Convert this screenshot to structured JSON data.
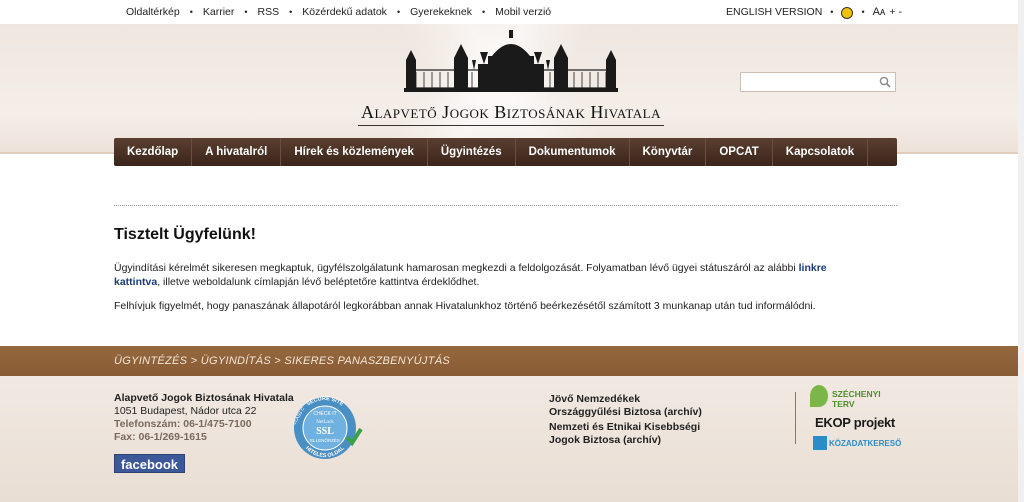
{
  "topbar": {
    "links": [
      "Oldaltérkép",
      "Karrier",
      "RSS",
      "Közérdekű adatok",
      "Gyerekeknek",
      "Mobil verzió"
    ],
    "english": "ENGLISH VERSION",
    "font_size": "Aᴀ",
    "plus_minus": "+ -"
  },
  "header": {
    "title": "Alapvető Jogok Biztosának Hivatala",
    "search_placeholder": ""
  },
  "nav": {
    "items": [
      "Kezdőlap",
      "A hivatalról",
      "Hírek és közlemények",
      "Ügyintézés",
      "Dokumentumok",
      "Könyvtár",
      "OPCAT",
      "Kapcsolatok"
    ]
  },
  "content": {
    "heading": "Tisztelt Ügyfelünk!",
    "p1_before": "Ügyindítási kérelmét sikeresen megkaptuk, ügyfélszolgálatunk hamarosan megkezdi a feldolgozását. Folyamatban lévő ügyei státuszáról az alábbi ",
    "p1_link": "linkre kattintva",
    "p1_after": ", illetve weboldalunk címlapján lévő beléptetőre kattintva érdeklődhet.",
    "p2": "Felhívjuk figyelmét, hogy panaszának állapotáról legkorábban annak Hivatalunkhoz történő beérkezésétől számított 3 munkanap után tud informálódni."
  },
  "breadcrumb": "ÜGYINTÉZÉS > ÜGYINDÍTÁS > SIKERES PANASZBENYÚJTÁS",
  "footer": {
    "org": "Alapvető Jogok Biztosának Hivatala",
    "address": "1051 Budapest, Nádor utca 22",
    "phone": "Telefonszám: 06-1/475-7100",
    "fax": "Fax: 06-1/269-1615",
    "facebook": "facebook",
    "ssl": {
      "check": "CHECK IT",
      "brand": "NetLock",
      "ssl": "SSL",
      "check2": "ELLENŐRZÉS",
      "top": "SECURE SITE",
      "left": "CLASS C",
      "bottom": "HITELES OLDAL"
    },
    "links": [
      "Jövő Nemzedékek",
      "Országgyűlési Biztosa (archív)",
      "Nemzeti és Etnikai Kisebbségi",
      "Jogok Biztosa (archív)"
    ],
    "szechenyi": "SZÉCHENYI TERV",
    "ekop": "EKOP projekt",
    "kozadat": "KÖZADATKERESŐ"
  }
}
